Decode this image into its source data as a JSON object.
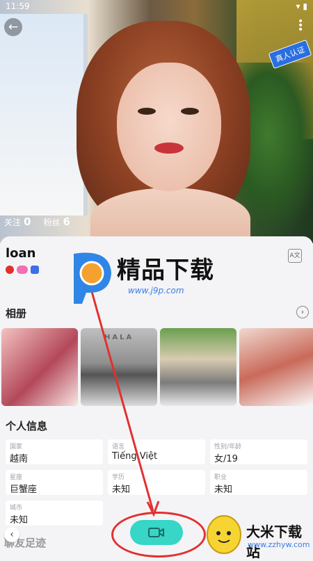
{
  "status": {
    "time": "11:59"
  },
  "profile": {
    "verified_label": "真人认证",
    "following_label": "关注",
    "following_count": "0",
    "followers_label": "粉丝",
    "followers_count": "6",
    "name": "loan"
  },
  "album": {
    "title": "相册"
  },
  "personal_info": {
    "title": "个人信息",
    "fields": [
      {
        "key": "国家",
        "value": "越南"
      },
      {
        "key": "语言",
        "value": "Tiếng Việt"
      },
      {
        "key": "性别/年龄",
        "value": "女/19"
      },
      {
        "key": "星座",
        "value": "巨蟹座"
      },
      {
        "key": "学历",
        "value": "未知"
      },
      {
        "key": "职业",
        "value": "未知"
      },
      {
        "key": "城市",
        "value": "未知"
      }
    ]
  },
  "footprints": {
    "title": "聊友足迹"
  },
  "watermarks": {
    "top_title": "精品下载",
    "top_url": "www.j9p.com",
    "bottom_title": "大米下载站",
    "bottom_url": "www.zzhyw.com"
  },
  "colors": {
    "accent": "#37d6c7",
    "verified_blue": "#2a6fe0",
    "annotation_red": "#e23030"
  },
  "icons": [
    "back-arrow-icon",
    "more-vertical-icon",
    "translate-icon",
    "chevron-right-icon",
    "chevron-left-icon",
    "video-camera-icon"
  ]
}
